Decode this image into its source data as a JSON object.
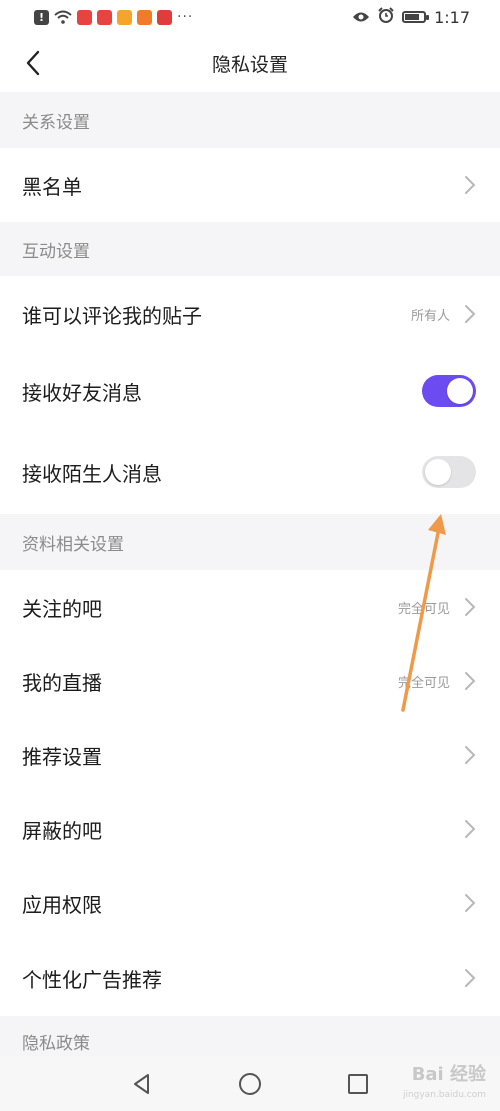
{
  "status_bar": {
    "time": "1:17",
    "battery_level": 0.8
  },
  "header": {
    "title": "隐私设置"
  },
  "sections": {
    "relationship": {
      "title": "关系设置",
      "blacklist": "黑名单"
    },
    "interaction": {
      "title": "互动设置",
      "comment_permission": {
        "label": "谁可以评论我的贴子",
        "value": "所有人"
      },
      "friend_messages": {
        "label": "接收好友消息",
        "enabled": true
      },
      "stranger_messages": {
        "label": "接收陌生人消息",
        "enabled": false
      }
    },
    "profile": {
      "title": "资料相关设置",
      "followed_bars": {
        "label": "关注的吧",
        "value": "完全可见"
      },
      "my_live": {
        "label": "我的直播",
        "value": "完全可见"
      },
      "recommend": {
        "label": "推荐设置"
      },
      "blocked_bars": {
        "label": "屏蔽的吧"
      },
      "app_permissions": {
        "label": "应用权限"
      },
      "personalized_ads": {
        "label": "个性化广告推荐"
      }
    },
    "privacy_policy": {
      "title": "隐私政策"
    }
  },
  "colors": {
    "accent": "#6c4cf0",
    "annotation_arrow": "#ef9a4a",
    "section_bg": "#f5f5f7"
  },
  "watermark": {
    "text": "Bai 经验",
    "sub": "jingyan.baidu.com"
  }
}
